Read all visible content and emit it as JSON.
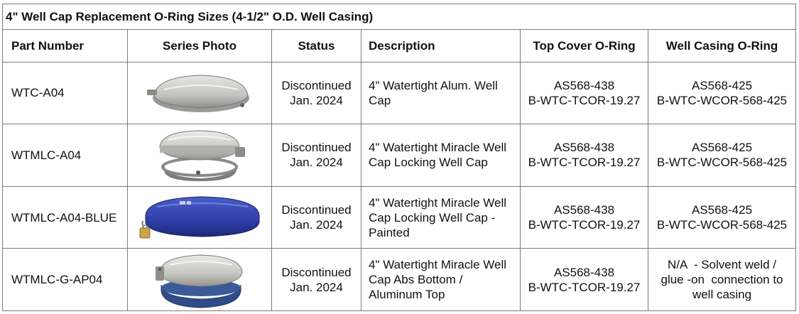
{
  "title": "4\" Well Cap Replacement O-Ring Sizes (4-1/2\" O.D. Well Casing)",
  "headers": {
    "part_number": "Part Number",
    "series_photo": "Series Photo",
    "status": "Status",
    "description": "Description",
    "top_cover": "Top Cover O-Ring",
    "well_casing": "Well Casing O-Ring"
  },
  "rows": [
    {
      "part_number": "WTC-A04",
      "photo": "aluminum-well-cap-photo",
      "status": [
        "Discontinued",
        "Jan. 2024"
      ],
      "description": [
        "4\" Watertight Alum. Well",
        "Cap"
      ],
      "top_cover": [
        "AS568-438",
        "B-WTC-TCOR-19.27"
      ],
      "well_casing": [
        "AS568-425",
        "B-WTC-WCOR-568-425"
      ]
    },
    {
      "part_number": "WTMLC-A04",
      "photo": "locking-well-cap-photo",
      "status": [
        "Discontinued",
        "Jan. 2024"
      ],
      "description": [
        "4\" Watertight Miracle Well",
        "Cap Locking Well Cap"
      ],
      "top_cover": [
        "AS568-438",
        "B-WTC-TCOR-19.27"
      ],
      "well_casing": [
        "AS568-425",
        "B-WTC-WCOR-568-425"
      ]
    },
    {
      "part_number": "WTMLC-A04-BLUE",
      "photo": "blue-painted-well-cap-photo",
      "status": [
        "Discontinued",
        "Jan. 2024"
      ],
      "description": [
        "4\" Watertight Miracle Well",
        "Cap Locking Well Cap -",
        "Painted"
      ],
      "top_cover": [
        "AS568-438",
        "B-WTC-TCOR-19.27"
      ],
      "well_casing": [
        "AS568-425",
        "B-WTC-WCOR-568-425"
      ]
    },
    {
      "part_number": "WTMLC-G-AP04",
      "photo": "abs-bottom-well-cap-photo",
      "status": [
        "Discontinued",
        "Jan. 2024"
      ],
      "description": [
        "4\" Watertight Miracle Well",
        "Cap Abs Bottom /",
        "Aluminum Top"
      ],
      "top_cover": [
        "AS568-438",
        "B-WTC-TCOR-19.27"
      ],
      "well_casing": [
        "N/A  - Solvent weld /",
        "glue -on  connection to",
        "well casing"
      ]
    }
  ],
  "colors": {
    "border": "#7a7a7a",
    "aluminum": "#c9c9c4",
    "blue_paint": "#2e3fa8",
    "abs_bottom": "#2f4c88"
  }
}
